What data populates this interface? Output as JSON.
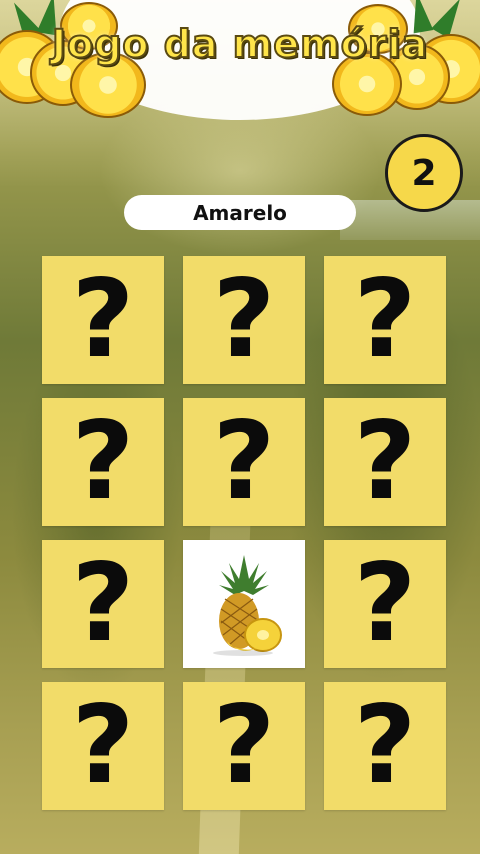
{
  "header": {
    "title": "Jogo da memória",
    "decoration_icon": "pineapple-slices-icon"
  },
  "score": {
    "value": "2"
  },
  "prompt": {
    "word": "Amarelo"
  },
  "grid": {
    "rows": 4,
    "columns": 3,
    "hidden_symbol": "?",
    "cards": [
      {
        "state": "hidden"
      },
      {
        "state": "hidden"
      },
      {
        "state": "hidden"
      },
      {
        "state": "hidden"
      },
      {
        "state": "hidden"
      },
      {
        "state": "hidden"
      },
      {
        "state": "hidden"
      },
      {
        "state": "revealed",
        "image": "pineapple-icon"
      },
      {
        "state": "hidden"
      },
      {
        "state": "hidden"
      },
      {
        "state": "hidden"
      },
      {
        "state": "hidden"
      }
    ]
  },
  "colors": {
    "card_back": "#f2dc69",
    "title_fill": "#ffe54a",
    "score_badge": "#f6d84a"
  }
}
